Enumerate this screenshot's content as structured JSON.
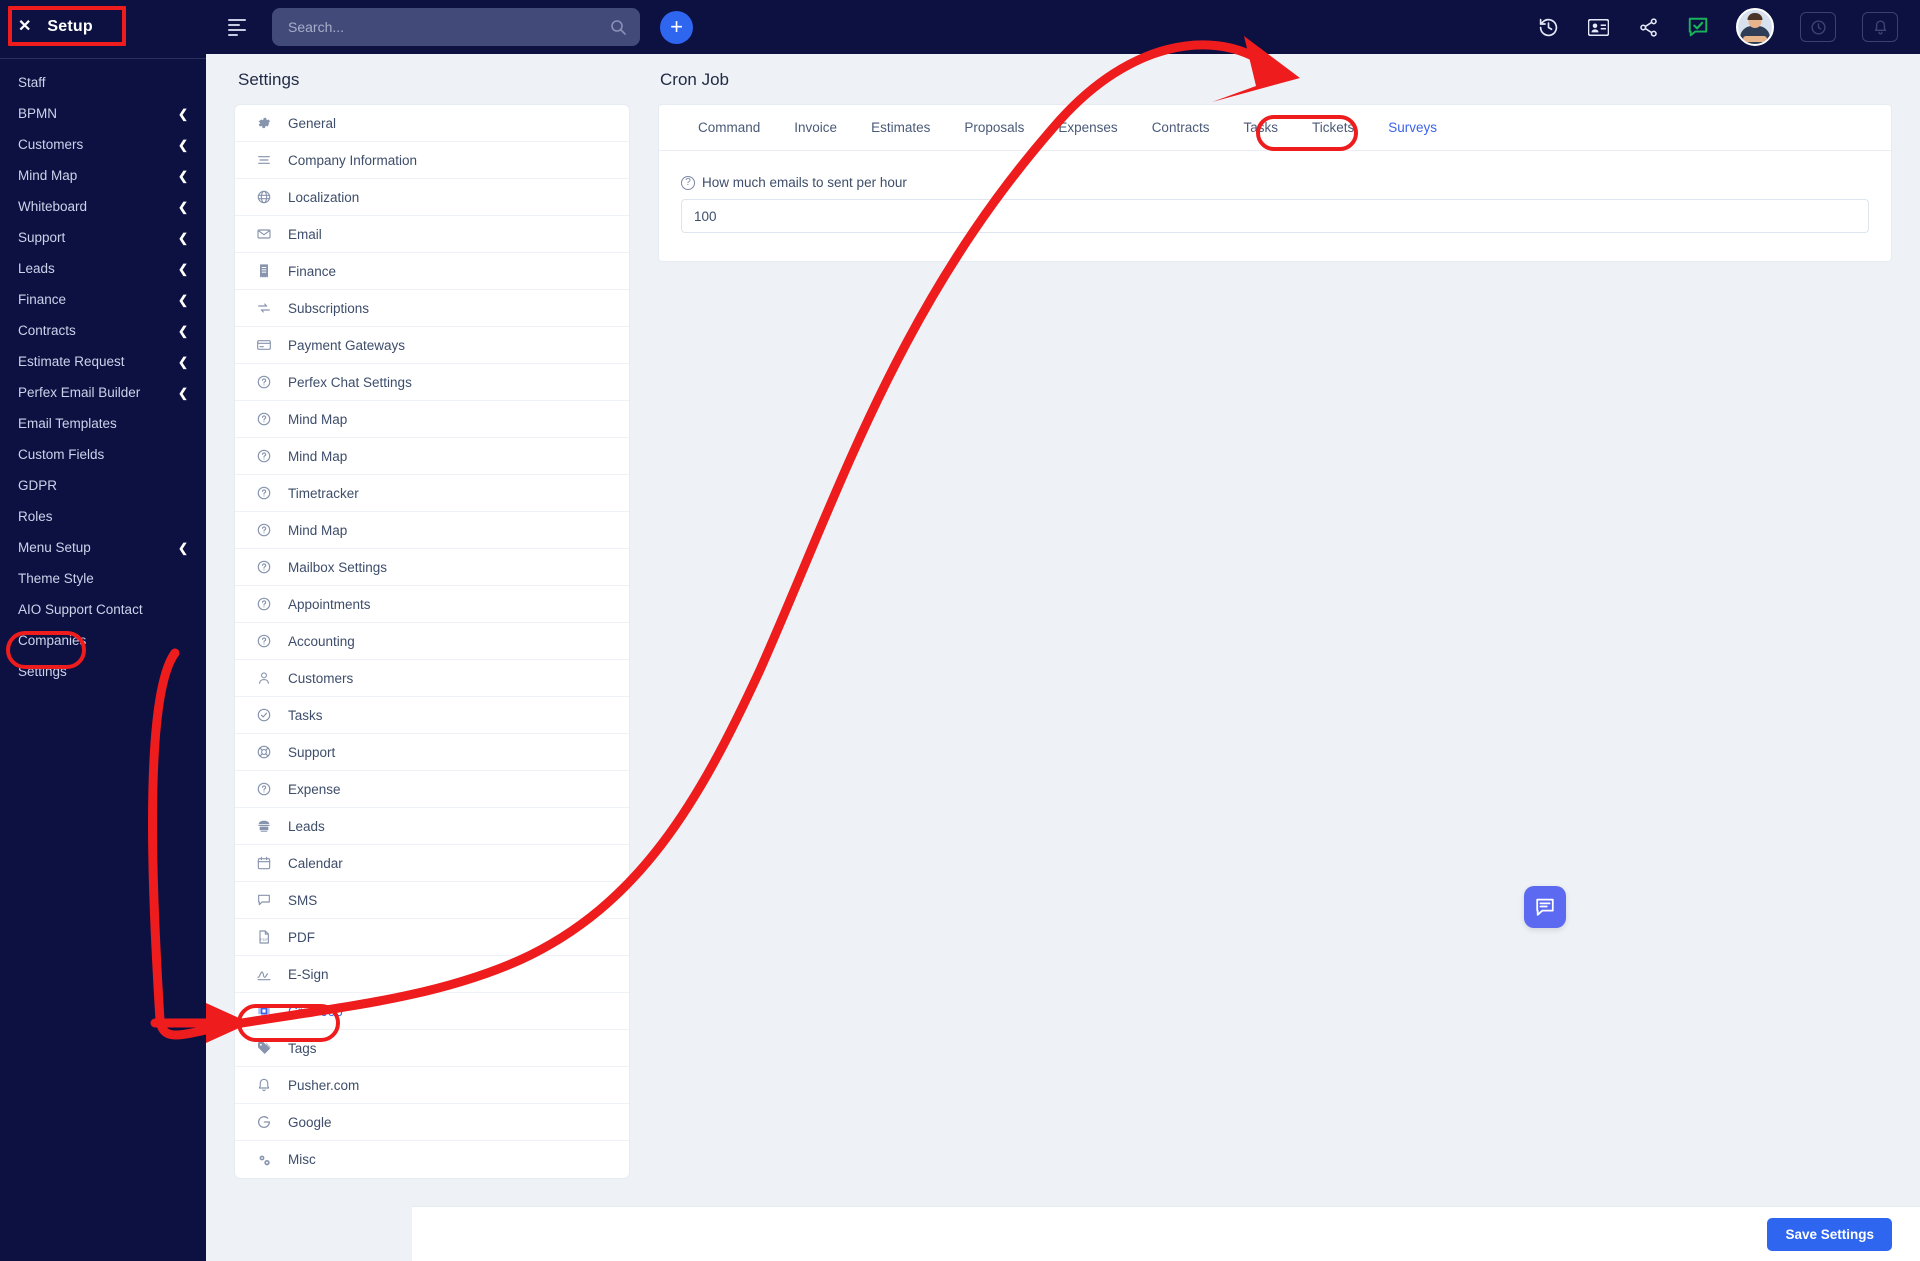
{
  "topbar": {
    "setup_close_glyph": "✕",
    "setup_title": "Setup",
    "hamburger_name": "menu-toggle-icon",
    "search": {
      "value": "",
      "placeholder": "Search..."
    },
    "add_button_label": "+",
    "icons": [
      {
        "name": "history-icon",
        "title": "History"
      },
      {
        "name": "contact-card-icon",
        "title": "Contacts"
      },
      {
        "name": "share-icon",
        "title": "Share"
      },
      {
        "name": "chat-approved-icon",
        "title": "Messages"
      }
    ],
    "avatar_name": "user-avatar",
    "right_buttons": [
      {
        "name": "timer-button",
        "icon": "clock-icon"
      },
      {
        "name": "notifications-button",
        "icon": "bell-icon"
      }
    ]
  },
  "sidebar": {
    "items": [
      {
        "label": "Staff",
        "has_chevron": false
      },
      {
        "label": "BPMN",
        "has_chevron": true
      },
      {
        "label": "Customers",
        "has_chevron": true
      },
      {
        "label": "Mind Map",
        "has_chevron": true
      },
      {
        "label": "Whiteboard",
        "has_chevron": true
      },
      {
        "label": "Support",
        "has_chevron": true
      },
      {
        "label": "Leads",
        "has_chevron": true
      },
      {
        "label": "Finance",
        "has_chevron": true
      },
      {
        "label": "Contracts",
        "has_chevron": true
      },
      {
        "label": "Estimate Request",
        "has_chevron": true
      },
      {
        "label": "Perfex Email Builder",
        "has_chevron": true
      },
      {
        "label": "Email Templates",
        "has_chevron": false
      },
      {
        "label": "Custom Fields",
        "has_chevron": false
      },
      {
        "label": "GDPR",
        "has_chevron": false
      },
      {
        "label": "Roles",
        "has_chevron": false
      },
      {
        "label": "Menu Setup",
        "has_chevron": true
      },
      {
        "label": "Theme Style",
        "has_chevron": false
      },
      {
        "label": "AIO Support Contact",
        "has_chevron": false
      },
      {
        "label": "Companies",
        "has_chevron": false
      },
      {
        "label": "Settings",
        "has_chevron": false
      }
    ],
    "chevron_glyph": "❮"
  },
  "settings_panel": {
    "heading": "Settings",
    "items": [
      {
        "label": "General",
        "icon": "gear-icon",
        "active": false
      },
      {
        "label": "Company Information",
        "icon": "lines-icon",
        "active": false
      },
      {
        "label": "Localization",
        "icon": "globe-icon",
        "active": false
      },
      {
        "label": "Email",
        "icon": "envelope-icon",
        "active": false
      },
      {
        "label": "Finance",
        "icon": "receipt-icon",
        "active": false
      },
      {
        "label": "Subscriptions",
        "icon": "refresh-icon",
        "active": false
      },
      {
        "label": "Payment Gateways",
        "icon": "credit-card-icon",
        "active": false
      },
      {
        "label": "Perfex Chat Settings",
        "icon": "question-circle-icon",
        "active": false
      },
      {
        "label": "Mind Map",
        "icon": "question-circle-icon",
        "active": false
      },
      {
        "label": "Mind Map",
        "icon": "question-circle-icon",
        "active": false
      },
      {
        "label": "Timetracker",
        "icon": "question-circle-icon",
        "active": false
      },
      {
        "label": "Mind Map",
        "icon": "question-circle-icon",
        "active": false
      },
      {
        "label": "Mailbox Settings",
        "icon": "question-circle-icon",
        "active": false
      },
      {
        "label": "Appointments",
        "icon": "question-circle-icon",
        "active": false
      },
      {
        "label": "Accounting",
        "icon": "question-circle-icon",
        "active": false
      },
      {
        "label": "Customers",
        "icon": "user-icon",
        "active": false
      },
      {
        "label": "Tasks",
        "icon": "check-circle-icon",
        "active": false
      },
      {
        "label": "Support",
        "icon": "lifebuoy-icon",
        "active": false
      },
      {
        "label": "Expense",
        "icon": "question-circle-icon",
        "active": false
      },
      {
        "label": "Leads",
        "icon": "telephone-icon",
        "active": false
      },
      {
        "label": "Calendar",
        "icon": "calendar-icon",
        "active": false
      },
      {
        "label": "SMS",
        "icon": "speech-bubble-icon",
        "active": false
      },
      {
        "label": "PDF",
        "icon": "pdf-file-icon",
        "active": false
      },
      {
        "label": "E-Sign",
        "icon": "signature-icon",
        "active": false
      },
      {
        "label": "Cron Job",
        "icon": "cpu-chip-icon",
        "active": true
      },
      {
        "label": "Tags",
        "icon": "tag-icon",
        "active": false
      },
      {
        "label": "Pusher.com",
        "icon": "bell-icon",
        "active": false
      },
      {
        "label": "Google",
        "icon": "google-g-icon",
        "active": false
      },
      {
        "label": "Misc",
        "icon": "gears-icon",
        "active": false
      }
    ]
  },
  "cron_panel": {
    "heading": "Cron Job",
    "tabs": [
      {
        "label": "Command",
        "active": false
      },
      {
        "label": "Invoice",
        "active": false
      },
      {
        "label": "Estimates",
        "active": false
      },
      {
        "label": "Proposals",
        "active": false
      },
      {
        "label": "Expenses",
        "active": false
      },
      {
        "label": "Contracts",
        "active": false
      },
      {
        "label": "Tasks",
        "active": false
      },
      {
        "label": "Tickets",
        "active": false
      },
      {
        "label": "Surveys",
        "active": true
      }
    ],
    "field": {
      "help_glyph": "?",
      "label": "How much emails to sent per hour",
      "value": "100",
      "placeholder": ""
    }
  },
  "chat_widget": {
    "name": "chat-launcher",
    "icon": "chat-bubble-icon"
  },
  "footer": {
    "save_label": "Save Settings"
  },
  "annotations": {
    "accent_color": "#ee1c1c",
    "marks": [
      {
        "name": "setup-highlight",
        "shape": "rect"
      },
      {
        "name": "settings-sidebar-highlight",
        "shape": "pill"
      },
      {
        "name": "cron-job-highlight",
        "shape": "pill"
      },
      {
        "name": "surveys-tab-highlight",
        "shape": "pill"
      }
    ]
  }
}
